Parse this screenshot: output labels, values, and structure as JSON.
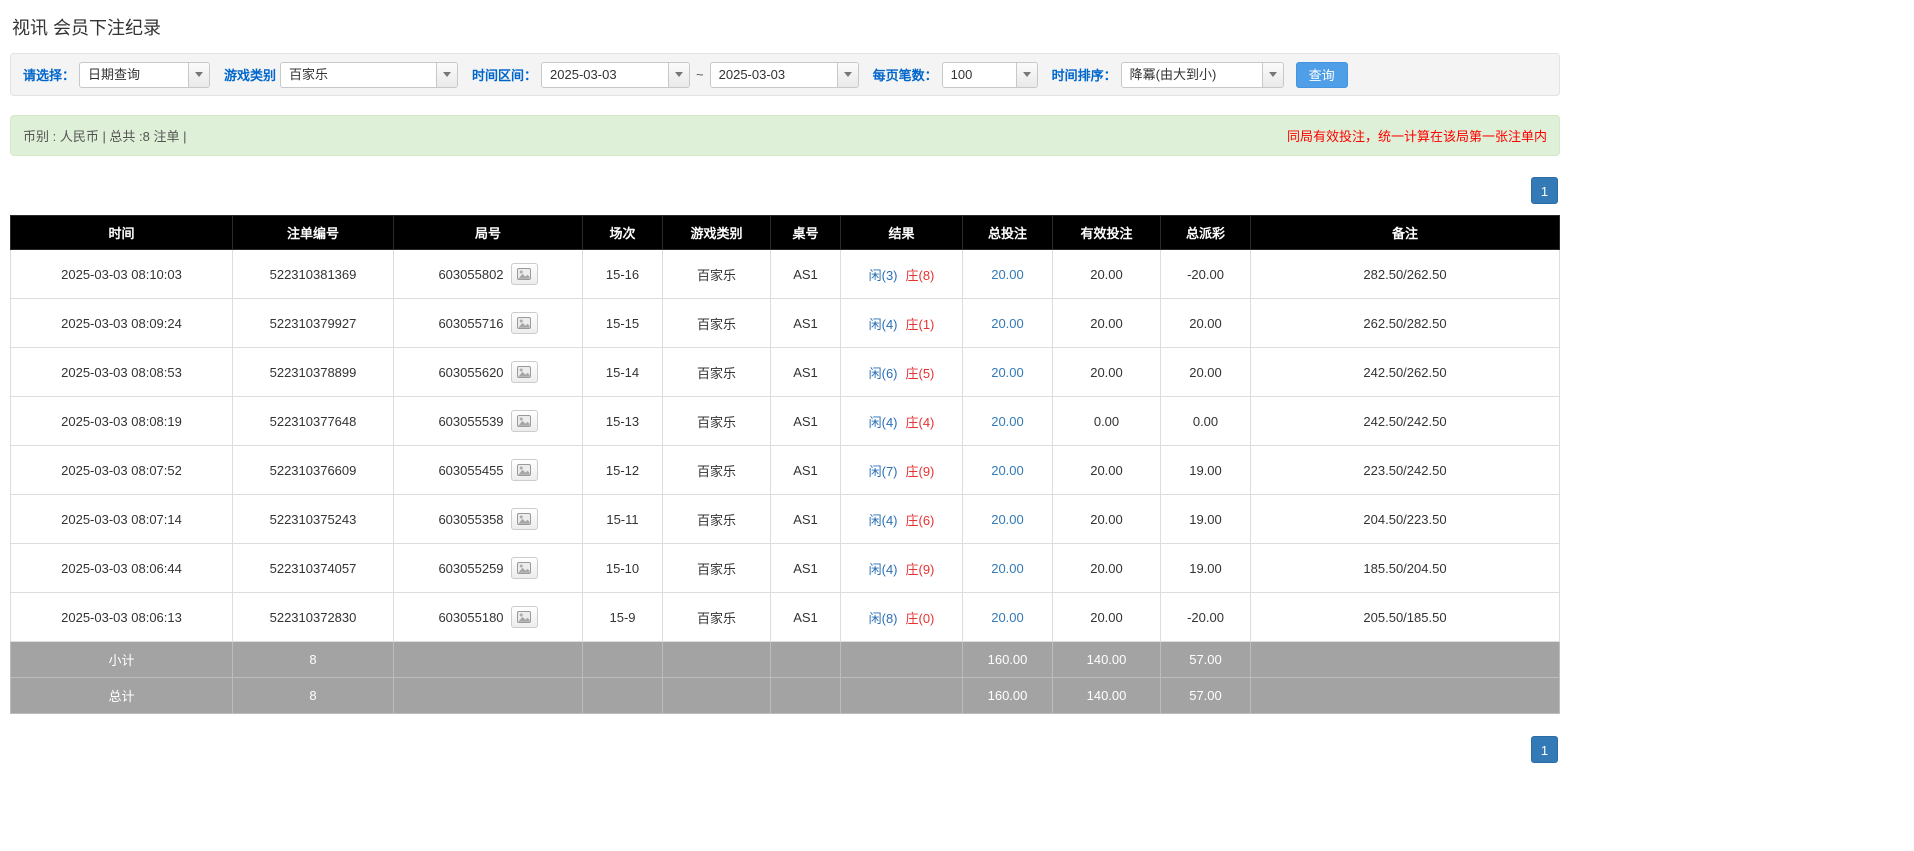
{
  "page": {
    "title": "视讯 会员下注纪录"
  },
  "filters": {
    "select_label": "请选择：",
    "select_value": "日期查询",
    "game_label": "游戏类别",
    "game_value": "百家乐",
    "range_label": "时间区间：",
    "date_from": "2025-03-03",
    "range_separator": "~",
    "date_to": "2025-03-03",
    "page_size_label": "每页笔数：",
    "page_size_value": "100",
    "sort_label": "时间排序：",
    "sort_value": "降冪(由大到小)",
    "search_button": "查询"
  },
  "summary": {
    "currency_info": "币别 : 人民币 | 总共 :8 注单 |",
    "notice": "同局有效投注，统一计算在该局第一张注单内"
  },
  "pagination": {
    "current_page": "1"
  },
  "table": {
    "headers": [
      "时间",
      "注单编号",
      "局号",
      "场次",
      "游戏类别",
      "桌号",
      "结果",
      "总投注",
      "有效投注",
      "总派彩",
      "备注"
    ],
    "rows": [
      {
        "time": "2025-03-03 08:10:03",
        "bet_id": "522310381369",
        "round_id": "603055802",
        "session": "15-16",
        "game": "百家乐",
        "table_no": "AS1",
        "result_player": "闲(3)",
        "result_banker": "庄(8)",
        "total_bet": "20.00",
        "valid_bet": "20.00",
        "payout": "-20.00",
        "remark": "282.50/262.50"
      },
      {
        "time": "2025-03-03 08:09:24",
        "bet_id": "522310379927",
        "round_id": "603055716",
        "session": "15-15",
        "game": "百家乐",
        "table_no": "AS1",
        "result_player": "闲(4)",
        "result_banker": "庄(1)",
        "total_bet": "20.00",
        "valid_bet": "20.00",
        "payout": "20.00",
        "remark": "262.50/282.50"
      },
      {
        "time": "2025-03-03 08:08:53",
        "bet_id": "522310378899",
        "round_id": "603055620",
        "session": "15-14",
        "game": "百家乐",
        "table_no": "AS1",
        "result_player": "闲(6)",
        "result_banker": "庄(5)",
        "total_bet": "20.00",
        "valid_bet": "20.00",
        "payout": "20.00",
        "remark": "242.50/262.50"
      },
      {
        "time": "2025-03-03 08:08:19",
        "bet_id": "522310377648",
        "round_id": "603055539",
        "session": "15-13",
        "game": "百家乐",
        "table_no": "AS1",
        "result_player": "闲(4)",
        "result_banker": "庄(4)",
        "total_bet": "20.00",
        "valid_bet": "0.00",
        "payout": "0.00",
        "remark": "242.50/242.50"
      },
      {
        "time": "2025-03-03 08:07:52",
        "bet_id": "522310376609",
        "round_id": "603055455",
        "session": "15-12",
        "game": "百家乐",
        "table_no": "AS1",
        "result_player": "闲(7)",
        "result_banker": "庄(9)",
        "total_bet": "20.00",
        "valid_bet": "20.00",
        "payout": "19.00",
        "remark": "223.50/242.50"
      },
      {
        "time": "2025-03-03 08:07:14",
        "bet_id": "522310375243",
        "round_id": "603055358",
        "session": "15-11",
        "game": "百家乐",
        "table_no": "AS1",
        "result_player": "闲(4)",
        "result_banker": "庄(6)",
        "total_bet": "20.00",
        "valid_bet": "20.00",
        "payout": "19.00",
        "remark": "204.50/223.50"
      },
      {
        "time": "2025-03-03 08:06:44",
        "bet_id": "522310374057",
        "round_id": "603055259",
        "session": "15-10",
        "game": "百家乐",
        "table_no": "AS1",
        "result_player": "闲(4)",
        "result_banker": "庄(9)",
        "total_bet": "20.00",
        "valid_bet": "20.00",
        "payout": "19.00",
        "remark": "185.50/204.50"
      },
      {
        "time": "2025-03-03 08:06:13",
        "bet_id": "522310372830",
        "round_id": "603055180",
        "session": "15-9",
        "game": "百家乐",
        "table_no": "AS1",
        "result_player": "闲(8)",
        "result_banker": "庄(0)",
        "total_bet": "20.00",
        "valid_bet": "20.00",
        "payout": "-20.00",
        "remark": "205.50/185.50"
      }
    ],
    "subtotal": {
      "label": "小计",
      "count": "8",
      "total_bet": "160.00",
      "valid_bet": "140.00",
      "payout": "57.00"
    },
    "total": {
      "label": "总计",
      "count": "8",
      "total_bet": "160.00",
      "valid_bet": "140.00",
      "payout": "57.00"
    }
  },
  "colors": {
    "accent_blue": "#337ab7",
    "player_blue": "#2a6fb5",
    "banker_red": "#e53333",
    "negative_red": "#ff0000",
    "header_bg": "#000000",
    "footer_bg": "#a3a3a3",
    "summary_bg": "#dff0d8"
  }
}
